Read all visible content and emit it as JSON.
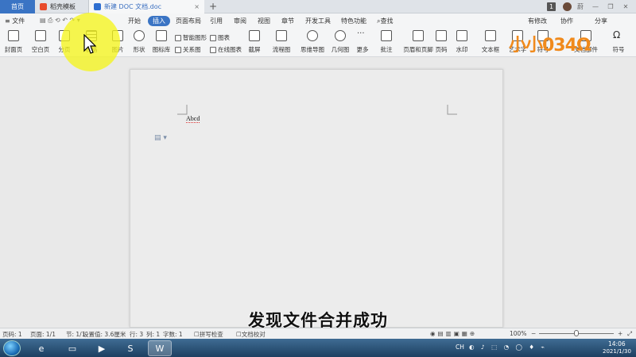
{
  "tabs": {
    "home": "首页",
    "template": "稻壳模板",
    "doc": "新建 DOC 文档.doc",
    "badge": "1",
    "user": "蔚"
  },
  "menu": {
    "file": "≡ 文件",
    "items": [
      "开始",
      "插入",
      "页面布局",
      "引用",
      "审阅",
      "视图",
      "章节",
      "开发工具",
      "特色功能"
    ],
    "search": "查找",
    "right": [
      "有修改",
      "协作",
      "分享"
    ]
  },
  "ribbon": {
    "large": [
      "封面页",
      "空白页",
      "分页",
      "表格",
      "图片",
      "形状",
      "图标库"
    ],
    "small_top": [
      "智能图形",
      "图表"
    ],
    "small_bottom": [
      "关系图",
      "在线图表"
    ],
    "large2": [
      "截屏",
      "流程图",
      "思维导图",
      "几何图",
      "更多",
      "批注",
      "页眉和页脚",
      "页码",
      "水印",
      "文本框",
      "艺术字",
      "符号",
      "文档部件",
      "符号"
    ]
  },
  "watermark": "小小034Ω",
  "document": {
    "text": "Abcd"
  },
  "subtitle": "发现文件合并成功",
  "status": {
    "page": "页码: 1",
    "pages": "页面: 1/1",
    "section": "节: 1/1",
    "position": "设置值: 3.6厘米",
    "line": "行: 3",
    "col": "列: 1",
    "words": "字数: 1",
    "spell": "拼写检查",
    "proof": "文档校对",
    "zoom": "100%"
  },
  "taskbar": {
    "ime": "CH",
    "time": "14:06",
    "date": "2021/1/30"
  },
  "colors": {
    "accent": "#3a74c4",
    "highlight": "#f5f51e",
    "watermark_orange": "#f08a1c",
    "watermark_blue": "#4aa3df"
  }
}
